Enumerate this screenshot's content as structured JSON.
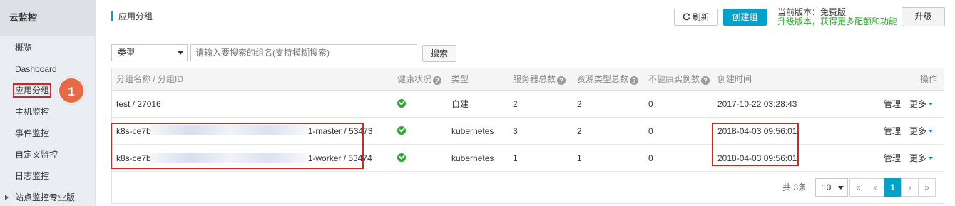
{
  "sidebar": {
    "title": "云监控",
    "items": [
      {
        "label": "概览"
      },
      {
        "label": "Dashboard"
      },
      {
        "label": "应用分组"
      },
      {
        "label": "主机监控"
      },
      {
        "label": "事件监控"
      },
      {
        "label": "自定义监控"
      },
      {
        "label": "日志监控"
      },
      {
        "label": "站点监控专业版"
      }
    ]
  },
  "step_badge": "1",
  "header": {
    "title": "应用分组",
    "refresh_label": "刷新",
    "create_label": "创建组",
    "version_current": "当前版本：免费版",
    "version_upgrade_hint": "升级版本，获得更多配额和功能",
    "upgrade_label": "升级"
  },
  "filter": {
    "type_select": "类型",
    "search_placeholder": "请输入要搜索的组名(支持模糊搜索)",
    "search_label": "搜索"
  },
  "table": {
    "columns": {
      "name": "分组名称 / 分组ID",
      "health": "健康状况",
      "type": "类型",
      "servers": "服务器总数",
      "resource_types": "资源类型总数",
      "unhealthy": "不健康实例数",
      "created": "创建时间",
      "actions": "操作"
    },
    "rows": [
      {
        "name_prefix": "test / 27016",
        "name_suffix": "",
        "type": "自建",
        "servers": "2",
        "resource_types": "2",
        "unhealthy": "0",
        "created": "2017-10-22 03:28:43",
        "manage": "管理",
        "more": "更多"
      },
      {
        "name_prefix": "k8s-ce7b",
        "name_suffix": "1-master / 53473",
        "type": "kubernetes",
        "servers": "3",
        "resource_types": "2",
        "unhealthy": "0",
        "created": "2018-04-03 09:56:01",
        "manage": "管理",
        "more": "更多"
      },
      {
        "name_prefix": "k8s-ce7b",
        "name_suffix": "1-worker / 53474",
        "type": "kubernetes",
        "servers": "1",
        "resource_types": "1",
        "unhealthy": "0",
        "created": "2018-04-03 09:56:01",
        "manage": "管理",
        "more": "更多"
      }
    ]
  },
  "pagination": {
    "total": "共 3条",
    "page_size": "10",
    "first": "«",
    "prev": "‹",
    "current": "1",
    "next": "›",
    "last": "»"
  },
  "colors": {
    "accent": "#00a2ca",
    "link": "#0a78c3",
    "success": "#2fa62f",
    "highlight_box": "#d9231c",
    "badge": "#e56a45"
  }
}
